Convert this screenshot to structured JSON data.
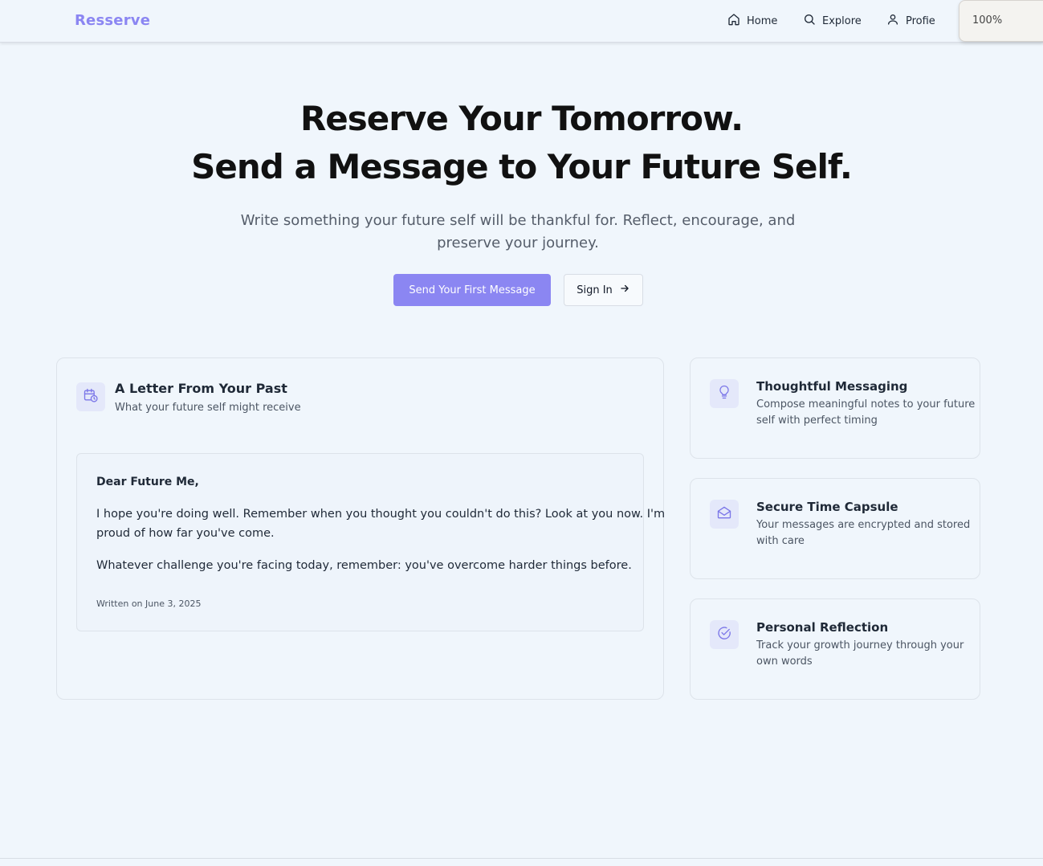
{
  "nav": {
    "brand": "Resserve",
    "items": [
      {
        "label": "Home",
        "icon": "home-icon"
      },
      {
        "label": "Explore",
        "icon": "search-icon"
      },
      {
        "label": "Profie",
        "icon": "user-icon"
      }
    ],
    "zoom": "100%"
  },
  "hero": {
    "title_line1": "Reserve Your Tomorrow.",
    "title_line2": "Send a Message to Your Future Self.",
    "subtitle": "Write something your future self will be thankful for. Reflect, encourage, and preserve your journey.",
    "primary_button": "Send Your First Message",
    "secondary_button": "Sign In"
  },
  "letter_card": {
    "icon": "calendar-clock-icon",
    "title": "A Letter From Your Past",
    "subtitle": "What your future self might receive",
    "greeting": "Dear Future Me,",
    "paragraph1_line1": "I hope you're doing well. Remember when you thought you couldn't do this? Look at you now. I'm",
    "paragraph1_line2": "proud of how far you've come.",
    "paragraph2": "Whatever challenge you're facing today, remember: you've overcome harder things before.",
    "written_on": "Written on June 3, 2025"
  },
  "features": [
    {
      "icon": "lightbulb-icon",
      "title": "Thoughtful Messaging",
      "desc_line1": "Compose meaningful notes to your future",
      "desc_line2": "self with perfect timing"
    },
    {
      "icon": "envelope-open-icon",
      "title": "Secure Time Capsule",
      "desc_line1": "Your messages are encrypted and stored",
      "desc_line2": "with care"
    },
    {
      "icon": "check-circle-icon",
      "title": "Personal Reflection",
      "desc_line1": "Track your growth journey through your",
      "desc_line2": "own words"
    }
  ],
  "colors": {
    "accent": "#8b86f2",
    "background": "#f0f6fc",
    "icon_tile": "#e4e8fa"
  }
}
